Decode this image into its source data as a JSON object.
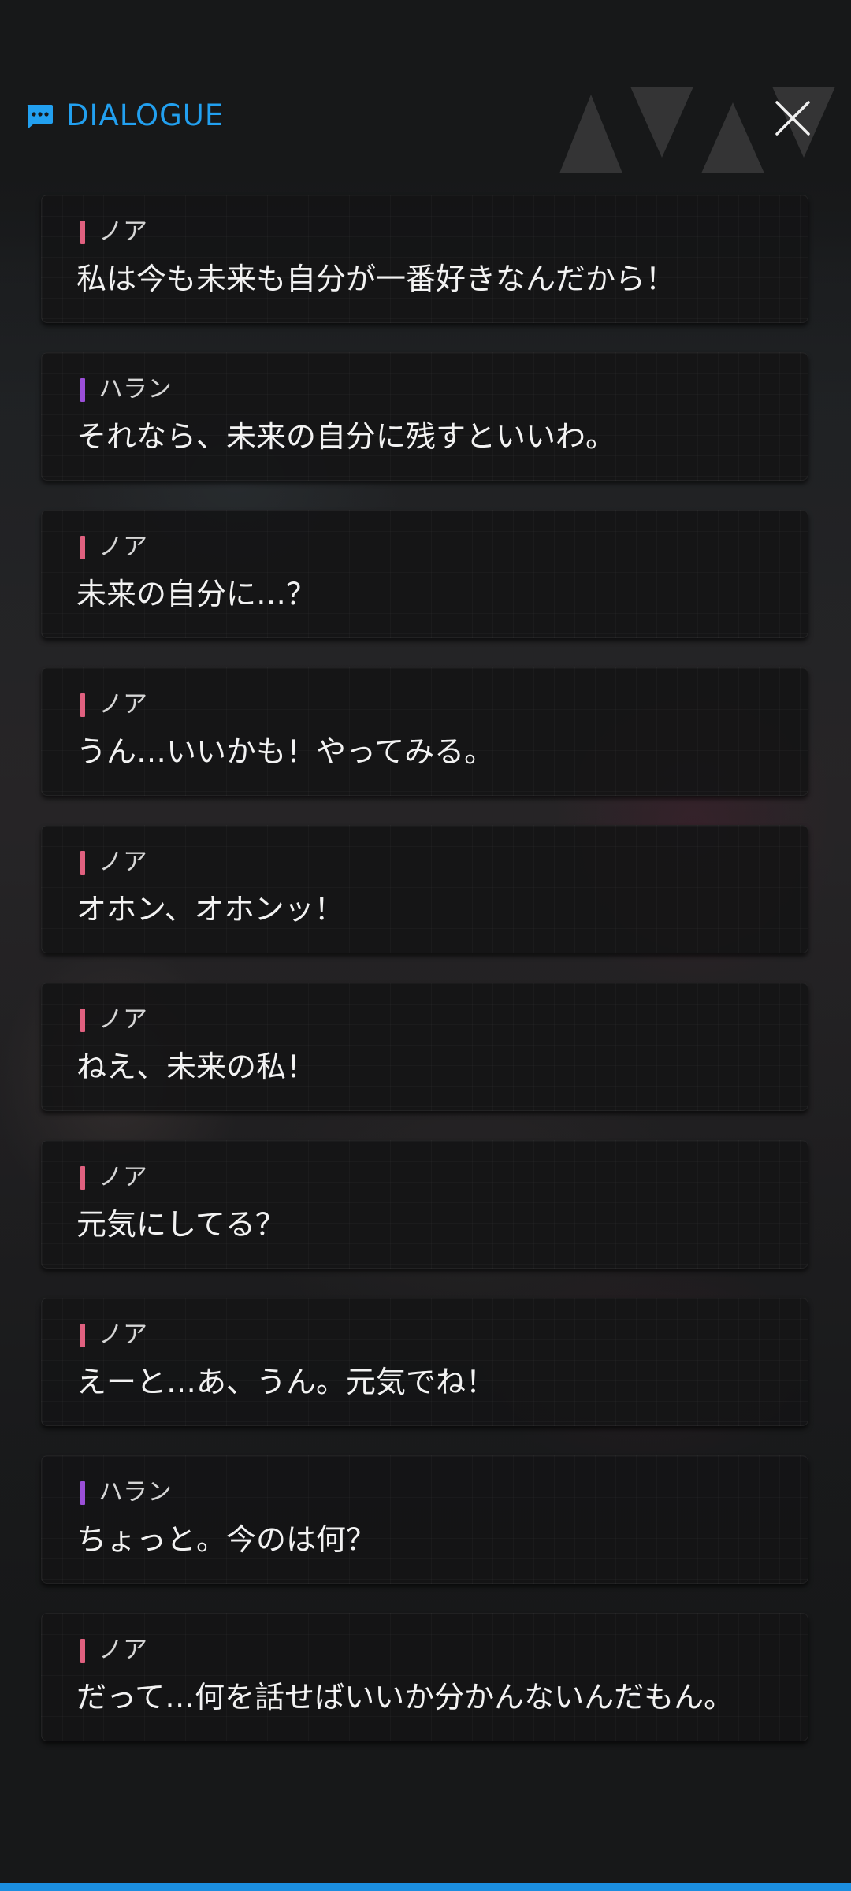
{
  "header": {
    "title": "DIALOGUE",
    "title_icon": "chat-bubble-icon",
    "close_icon": "close-icon"
  },
  "colors": {
    "accent": "#22a0f0",
    "speaker_noa": "#e0607f",
    "speaker_haran": "#9b4fd8"
  },
  "dialogue": [
    {
      "speaker": "ノア",
      "text": "私は今も未来も自分が一番好きなんだから！",
      "color": "#e0607f"
    },
    {
      "speaker": "ハラン",
      "text": "それなら、未来の自分に残すといいわ。",
      "color": "#9b4fd8"
    },
    {
      "speaker": "ノア",
      "text": "未来の自分に…？",
      "color": "#e0607f"
    },
    {
      "speaker": "ノア",
      "text": "うん…いいかも！やってみる。",
      "color": "#e0607f"
    },
    {
      "speaker": "ノア",
      "text": "オホン、オホンッ！",
      "color": "#e0607f"
    },
    {
      "speaker": "ノア",
      "text": "ねえ、未来の私！",
      "color": "#e0607f"
    },
    {
      "speaker": "ノア",
      "text": "元気にしてる？",
      "color": "#e0607f"
    },
    {
      "speaker": "ノア",
      "text": "えーと…あ、うん。元気でね！",
      "color": "#e0607f"
    },
    {
      "speaker": "ハラン",
      "text": "ちょっと。今のは何？",
      "color": "#9b4fd8"
    },
    {
      "speaker": "ノア",
      "text": "だって…何を話せばいいか分かんないんだもん。",
      "color": "#e0607f"
    }
  ]
}
